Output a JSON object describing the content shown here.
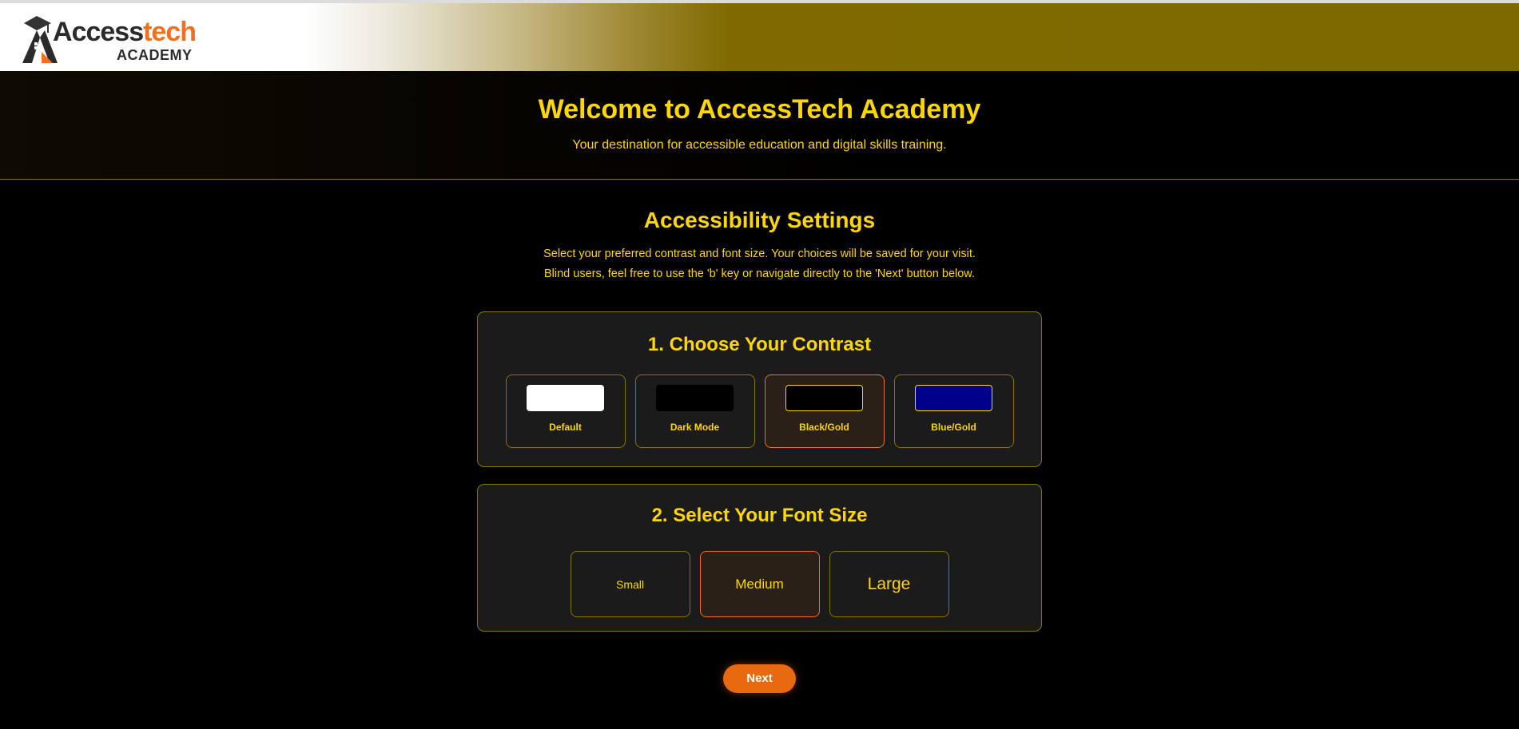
{
  "header": {
    "logo": {
      "brand_part1": "A",
      "brand_part2": "ccess",
      "brand_part3": "tech",
      "sub": "ACADEMY"
    }
  },
  "hero": {
    "title": "Welcome to AccessTech Academy",
    "subtitle": "Your destination for accessible education and digital skills training."
  },
  "settings": {
    "title": "Accessibility Settings",
    "intro_line1": "Select your preferred contrast and font size. Your choices will be saved for your visit.",
    "intro_line2": "Blind users, feel free to use the 'b' key or navigate directly to the 'Next' button below."
  },
  "contrast": {
    "title": "1. Choose Your Contrast",
    "options": [
      {
        "label": "Default",
        "swatch_color": "#ffffff"
      },
      {
        "label": "Dark Mode",
        "swatch_color": "#000000"
      },
      {
        "label": "Black/Gold",
        "swatch_color": "#000000"
      },
      {
        "label": "Blue/Gold",
        "swatch_color": "#00008b"
      }
    ],
    "selected": "Black/Gold"
  },
  "font": {
    "title": "2. Select Your Font Size",
    "options": [
      {
        "label": "Small"
      },
      {
        "label": "Medium"
      },
      {
        "label": "Large"
      }
    ],
    "selected": "Medium"
  },
  "next_label": "Next",
  "colors": {
    "accent_gold": "#ffd700",
    "accent_orange": "#e8690f",
    "panel_bg": "#1b1b1b",
    "page_bg": "#000000"
  }
}
